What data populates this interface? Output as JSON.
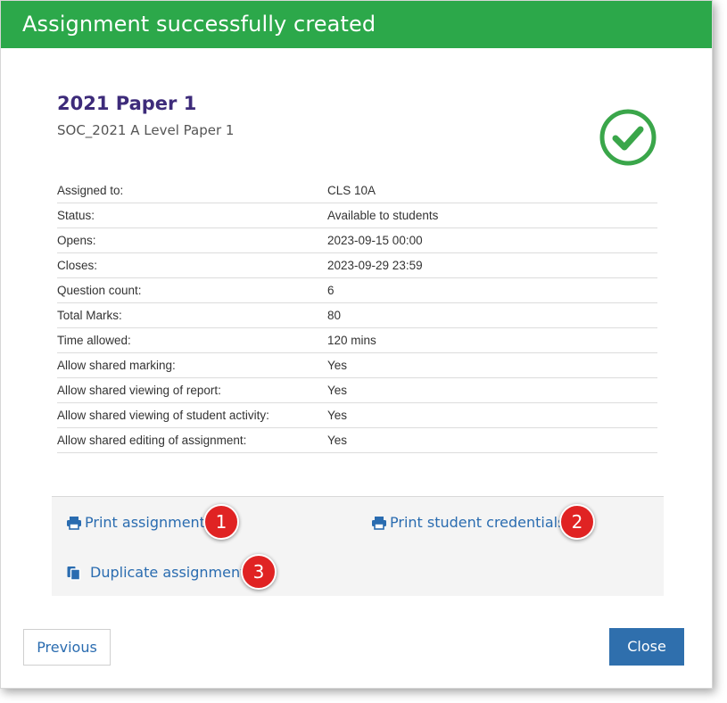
{
  "header": {
    "title": "Assignment successfully created"
  },
  "assignment": {
    "title": "2021 Paper 1",
    "subtitle": "SOC_2021 A Level Paper 1"
  },
  "details": [
    {
      "label": "Assigned to:",
      "value": "CLS 10A"
    },
    {
      "label": "Status:",
      "value": "Available to students"
    },
    {
      "label": "Opens:",
      "value": "2023-09-15 00:00"
    },
    {
      "label": "Closes:",
      "value": "2023-09-29 23:59"
    },
    {
      "label": "Question count:",
      "value": "6"
    },
    {
      "label": "Total Marks:",
      "value": "80"
    },
    {
      "label": "Time allowed:",
      "value": "120 mins"
    },
    {
      "label": "Allow shared marking:",
      "value": "Yes"
    },
    {
      "label": "Allow shared viewing of report:",
      "value": "Yes"
    },
    {
      "label": "Allow shared viewing of student activity:",
      "value": "Yes"
    },
    {
      "label": "Allow shared editing of assignment:",
      "value": "Yes"
    }
  ],
  "actions": {
    "print_assignment": {
      "label": "Print assignment",
      "icon": "printer-icon",
      "badge": "1"
    },
    "print_credentials": {
      "label": "Print student credentials",
      "icon": "printer-icon",
      "badge": "2"
    },
    "duplicate": {
      "label": "Duplicate assignment",
      "icon": "copy-icon",
      "badge": "3"
    }
  },
  "footer": {
    "previous_label": "Previous",
    "close_label": "Close"
  },
  "colors": {
    "header_bg": "#2ca84a",
    "title": "#3d2b7a",
    "link": "#2a6cb0",
    "badge": "#e02323",
    "close_button": "#2f6fad",
    "success_icon": "#3aa64a"
  }
}
